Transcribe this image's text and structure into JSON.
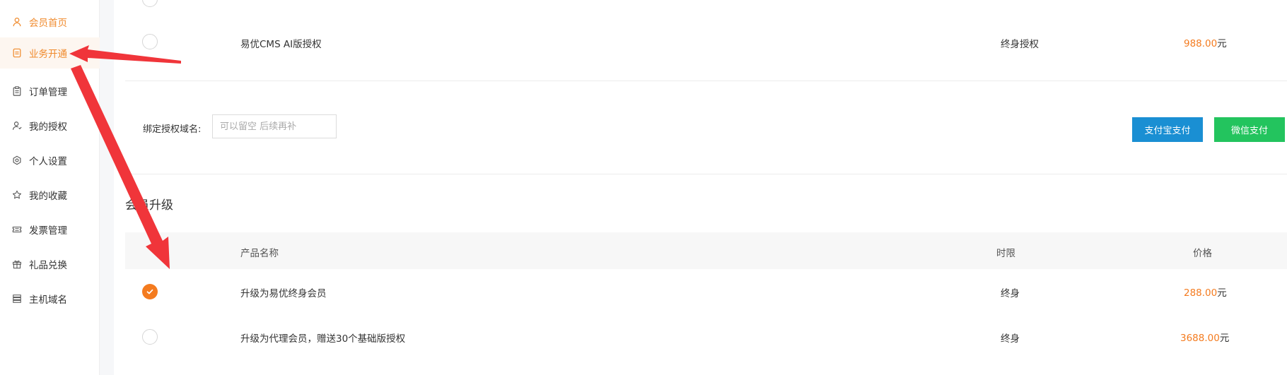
{
  "sidebar": {
    "items": [
      {
        "label": "会员首页",
        "icon": "user-icon"
      },
      {
        "label": "业务开通",
        "icon": "document-icon"
      },
      {
        "label": "订单管理",
        "icon": "clipboard-icon"
      },
      {
        "label": "我的授权",
        "icon": "user-key-icon"
      },
      {
        "label": "个人设置",
        "icon": "settings-icon"
      },
      {
        "label": "我的收藏",
        "icon": "star-icon"
      },
      {
        "label": "发票管理",
        "icon": "ticket-icon"
      },
      {
        "label": "礼品兑换",
        "icon": "gift-icon"
      },
      {
        "label": "主机域名",
        "icon": "server-icon"
      }
    ],
    "accent_color": "#f08a2c"
  },
  "license_rows": [
    {
      "name": "易优CMS AI版授权",
      "period": "终身授权",
      "price": "988.00",
      "unit": "元",
      "selected": false
    }
  ],
  "domain": {
    "label": "绑定授权域名:",
    "placeholder": "可以留空 后续再补"
  },
  "payment": {
    "alipay_label": "支付宝支付",
    "wechat_label": "微信支付",
    "alipay_color": "#1a8fd3",
    "wechat_color": "#23c45e"
  },
  "upgrade": {
    "title": "会员升级",
    "headers": {
      "name": "产品名称",
      "period": "时限",
      "price": "价格"
    },
    "rows": [
      {
        "name": "升级为易优终身会员",
        "period": "终身",
        "price": "288.00",
        "unit": "元",
        "selected": true
      },
      {
        "name": "升级为代理会员，赠送30个基础版授权",
        "period": "终身",
        "price": "3688.00",
        "unit": "元",
        "selected": false
      }
    ]
  },
  "colors": {
    "price": "#f47b1f",
    "arrow": "#f0353a"
  }
}
